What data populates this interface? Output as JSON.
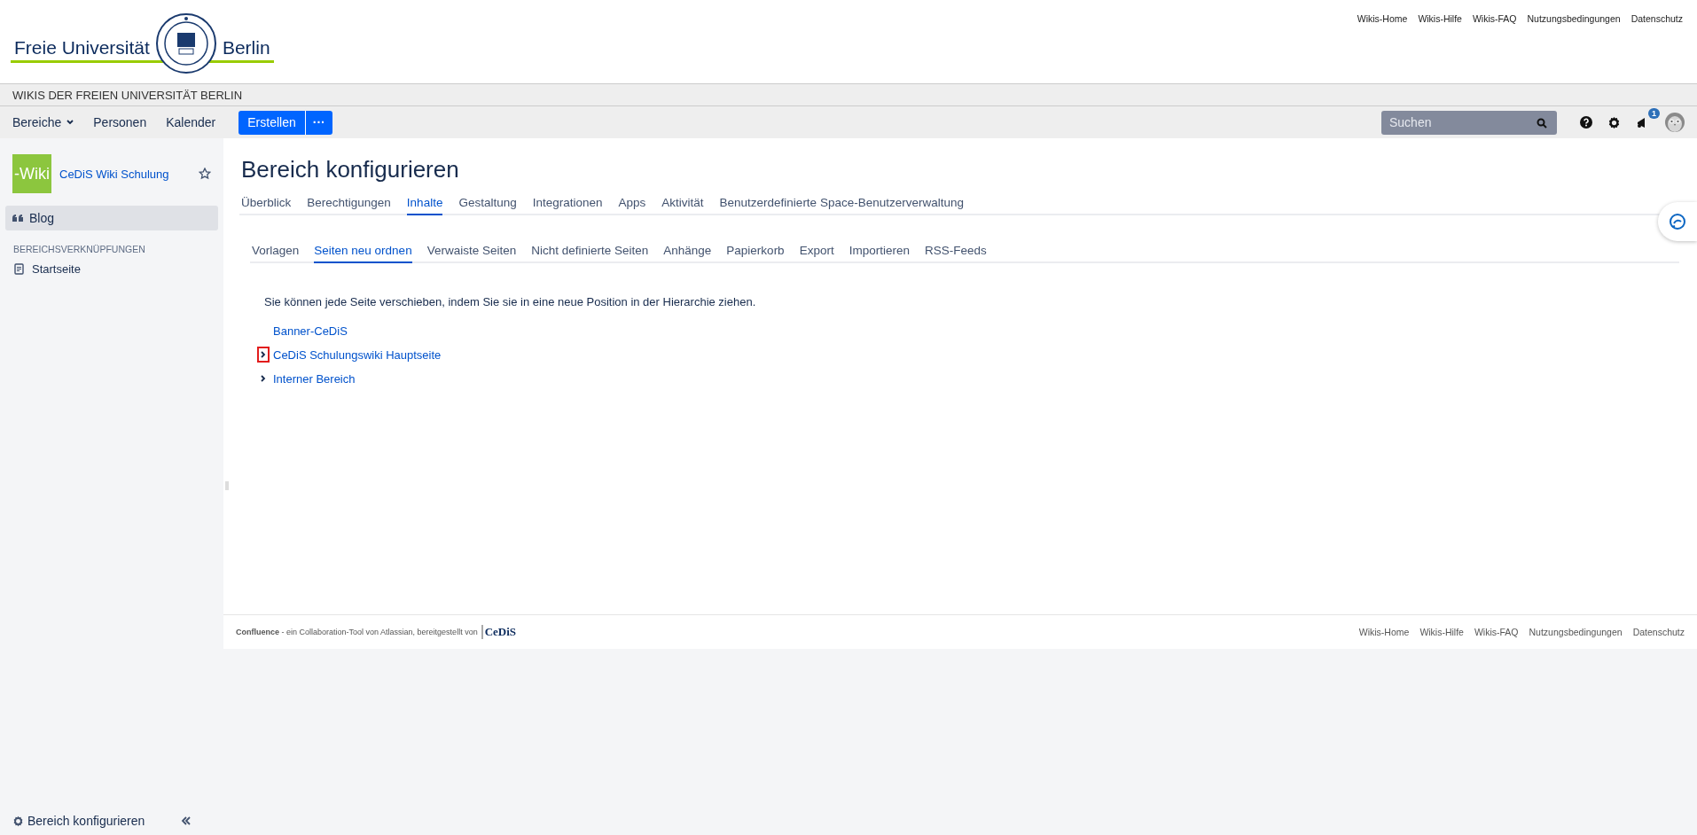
{
  "header": {
    "logo_left": "Freie Universität",
    "logo_right": "Berlin",
    "links": [
      "Wikis-Home",
      "Wikis-Hilfe",
      "Wikis-FAQ",
      "Nutzungsbedingungen",
      "Datenschutz"
    ]
  },
  "banner": {
    "title": "WIKIS DER FREIEN UNIVERSITÄT BERLIN"
  },
  "nav": {
    "items": [
      {
        "label": "Bereiche",
        "dropdown": true
      },
      {
        "label": "Personen",
        "dropdown": false
      },
      {
        "label": "Kalender",
        "dropdown": false
      }
    ],
    "create": "Erstellen",
    "more": "···",
    "search": {
      "placeholder": "Suchen"
    },
    "notifications": "1"
  },
  "sidebar": {
    "space_logo": "-Wiki",
    "space_name": "CeDiS Wiki Schulung",
    "items": [
      {
        "label": "Blog",
        "selected": true
      }
    ],
    "section": "BEREICHSVERKNÜPFUNGEN",
    "links": [
      "Startseite"
    ],
    "footer": "Bereich konfigurieren"
  },
  "page": {
    "title": "Bereich konfigurieren",
    "tabs": [
      {
        "label": "Überblick",
        "selected": false
      },
      {
        "label": "Berechtigungen",
        "selected": false
      },
      {
        "label": "Inhalte",
        "selected": true
      },
      {
        "label": "Gestaltung",
        "selected": false
      },
      {
        "label": "Integrationen",
        "selected": false
      },
      {
        "label": "Apps",
        "selected": false
      },
      {
        "label": "Aktivität",
        "selected": false
      },
      {
        "label": "Benutzerdefinierte Space-Benutzerverwaltung",
        "selected": false
      }
    ],
    "subtabs": [
      {
        "label": "Vorlagen",
        "selected": false
      },
      {
        "label": "Seiten neu ordnen",
        "selected": true
      },
      {
        "label": "Verwaiste Seiten",
        "selected": false
      },
      {
        "label": "Nicht definierte Seiten",
        "selected": false
      },
      {
        "label": "Anhänge",
        "selected": false
      },
      {
        "label": "Papierkorb",
        "selected": false
      },
      {
        "label": "Export",
        "selected": false
      },
      {
        "label": "Importieren",
        "selected": false
      },
      {
        "label": "RSS-Feeds",
        "selected": false
      }
    ],
    "intro": "Sie können jede Seite verschieben, indem Sie sie in eine neue Position in der Hierarchie ziehen.",
    "tree": [
      {
        "label": "Banner-CeDiS",
        "has_children": false,
        "highlighted": false
      },
      {
        "label": "CeDiS Schulungswiki Hauptseite",
        "has_children": true,
        "highlighted": true
      },
      {
        "label": "Interner Bereich",
        "has_children": true,
        "highlighted": false
      }
    ]
  },
  "footer": {
    "text": "**Confluence** - ein Collaboration-Tool von Atlassian, bereitgestellt von",
    "logo": "CeDiS",
    "links": [
      "Wikis-Home",
      "Wikis-Hilfe",
      "Wikis-FAQ",
      "Nutzungsbedingungen",
      "Datenschutz"
    ]
  }
}
